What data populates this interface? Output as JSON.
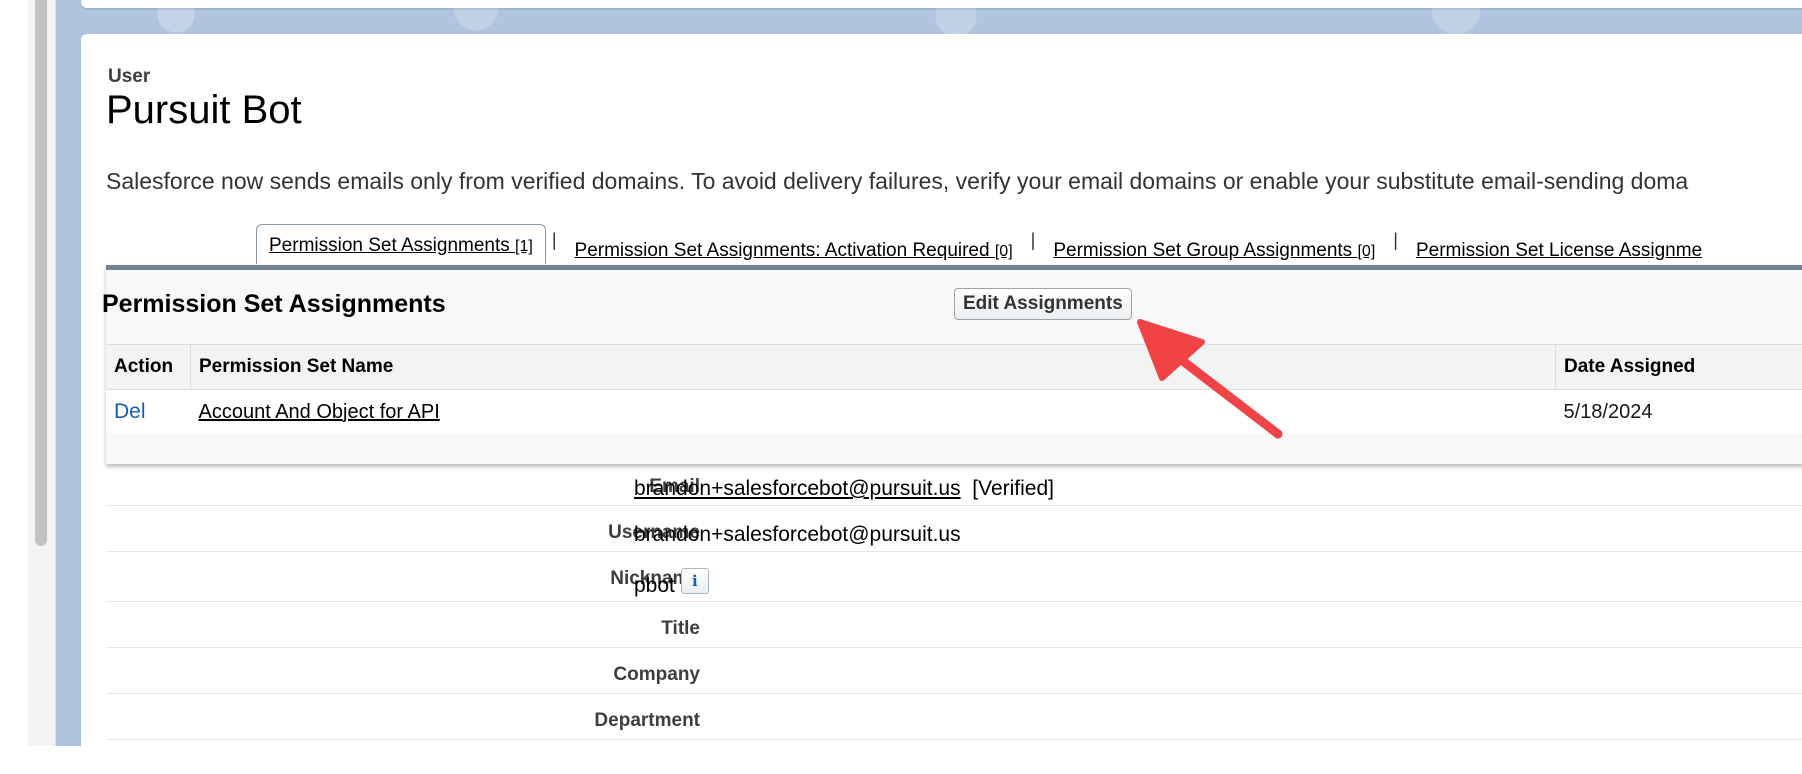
{
  "header": {
    "object_label": "User",
    "page_title": "Pursuit Bot",
    "notice": "Salesforce now sends emails only from verified domains. To avoid delivery failures, verify your email domains or enable your substitute email-sending doma"
  },
  "tabs": [
    {
      "label": "Permission Set Assignments",
      "count": "[1]"
    },
    {
      "label": "Permission Set Assignments: Activation Required",
      "count": "[0]"
    },
    {
      "label": "Permission Set Group Assignments",
      "count": "[0]"
    },
    {
      "label": "Permission Set License Assignme",
      "count": ""
    }
  ],
  "tab_separator": "|",
  "related_list": {
    "title": "Permission Set Assignments",
    "edit_button": "Edit Assignments",
    "columns": [
      "Action",
      "Permission Set Name",
      "Date Assigned"
    ],
    "rows": [
      {
        "action": "Del",
        "name": "Account And Object for API",
        "date": "5/18/2024"
      }
    ]
  },
  "detail": [
    {
      "label": "Email",
      "value": "brandon+salesforcebot@pursuit.us",
      "suffix": "[Verified]"
    },
    {
      "label": "Username",
      "value": "brandon+salesforcebot@pursuit.us"
    },
    {
      "label": "Nickname",
      "value": "pbot",
      "info_icon": "i"
    },
    {
      "label": "Title",
      "value": ""
    },
    {
      "label": "Company",
      "value": ""
    },
    {
      "label": "Department",
      "value": ""
    }
  ],
  "colors": {
    "link_blue": "#1a5cb0",
    "setup_background": "#b0c4df",
    "list_header_border": "#758296",
    "annotation_arrow": "#ef4346"
  }
}
